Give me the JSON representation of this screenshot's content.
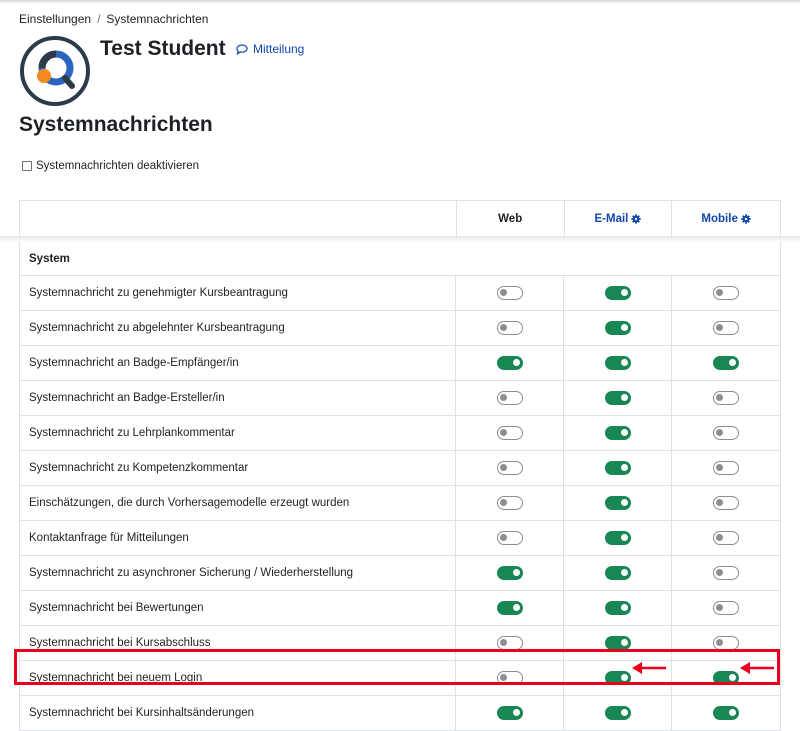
{
  "breadcrumb": {
    "items": [
      "Einstellungen",
      "Systemnachrichten"
    ],
    "separator": "/"
  },
  "profile": {
    "name": "Test Student",
    "message_label": "Mitteilung"
  },
  "page": {
    "title": "Systemnachrichten",
    "disable_label": "Systemnachrichten deaktivieren"
  },
  "table": {
    "headers": {
      "web": "Web",
      "email": "E-Mail",
      "mobile": "Mobile"
    },
    "section": "System",
    "rows": [
      {
        "label": "Systemnachricht zu genehmigter Kursbeantragung",
        "web": false,
        "email": true,
        "mobile": false
      },
      {
        "label": "Systemnachricht zu abgelehnter Kursbeantragung",
        "web": false,
        "email": true,
        "mobile": false
      },
      {
        "label": "Systemnachricht an Badge-Empfänger/in",
        "web": true,
        "email": true,
        "mobile": true
      },
      {
        "label": "Systemnachricht an Badge-Ersteller/in",
        "web": false,
        "email": true,
        "mobile": false
      },
      {
        "label": "Systemnachricht zu Lehrplankommentar",
        "web": false,
        "email": true,
        "mobile": false
      },
      {
        "label": "Systemnachricht zu Kompetenzkommentar",
        "web": false,
        "email": true,
        "mobile": false
      },
      {
        "label": "Einschätzungen, die durch Vorhersagemodelle erzeugt wurden",
        "web": false,
        "email": true,
        "mobile": false
      },
      {
        "label": "Kontaktanfrage für Mitteilungen",
        "web": false,
        "email": true,
        "mobile": false
      },
      {
        "label": "Systemnachricht zu asynchroner Sicherung / Wiederherstellung",
        "web": true,
        "email": true,
        "mobile": false
      },
      {
        "label": "Systemnachricht bei Bewertungen",
        "web": true,
        "email": true,
        "mobile": false
      },
      {
        "label": "Systemnachricht bei Kursabschluss",
        "web": false,
        "email": true,
        "mobile": false
      },
      {
        "label": "Systemnachricht bei neuem Login",
        "web": false,
        "email": true,
        "mobile": true
      },
      {
        "label": "Systemnachricht bei Kursinhaltsänderungen",
        "web": true,
        "email": true,
        "mobile": true
      }
    ]
  },
  "colors": {
    "toggle_on": "#198754",
    "toggle_off": "#8a8f94",
    "link": "#0f47ad",
    "annotation": "#e8001c"
  },
  "icons": {
    "message": "speech-bubble-icon",
    "settings": "gear-icon"
  }
}
